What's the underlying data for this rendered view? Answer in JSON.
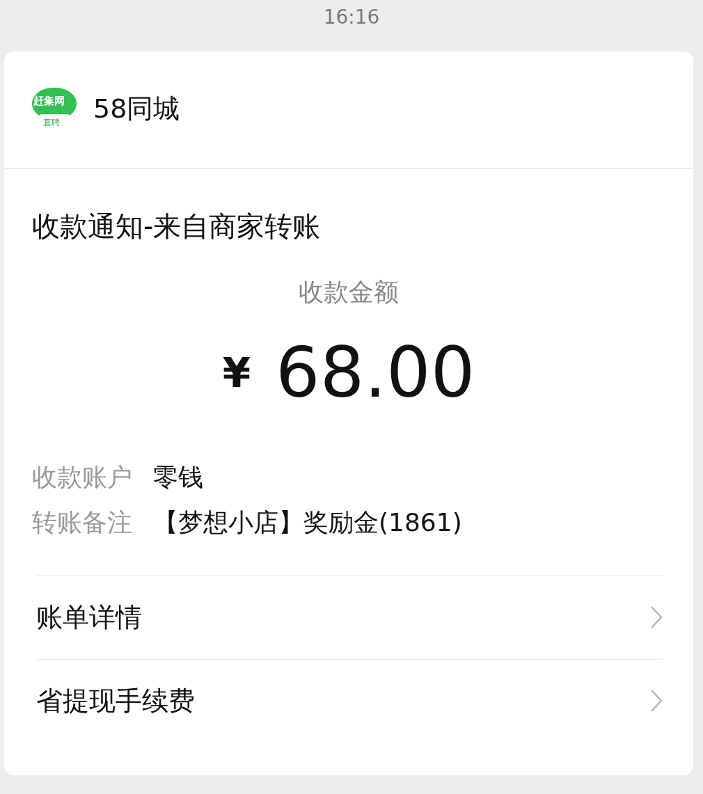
{
  "status_bar": {
    "time": "16:16"
  },
  "sender": {
    "logo_top": "赶集网",
    "logo_bottom": "直聘",
    "name": "58同城"
  },
  "title": "收款通知-来自商家转账",
  "amount": {
    "label": "收款金额",
    "currency": "¥",
    "value": "68.00"
  },
  "details": [
    {
      "label": "收款账户",
      "value": "零钱"
    },
    {
      "label": "转账备注",
      "value": "【梦想小店】奖励金(1861)"
    }
  ],
  "links": [
    {
      "label": "账单详情"
    },
    {
      "label": "省提现手续费"
    }
  ]
}
